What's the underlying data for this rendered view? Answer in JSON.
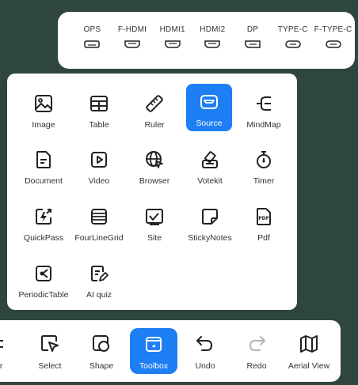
{
  "source_bar": {
    "items": [
      {
        "label": "OPS",
        "icon": "ops-port-icon"
      },
      {
        "label": "F-HDMI",
        "icon": "hdmi-port-icon"
      },
      {
        "label": "HDMI1",
        "icon": "hdmi-port-icon"
      },
      {
        "label": "HDMI2",
        "icon": "hdmi-port-icon"
      },
      {
        "label": "DP",
        "icon": "dp-port-icon"
      },
      {
        "label": "TYPE-C",
        "icon": "usb-c-port-icon"
      },
      {
        "label": "F-TYPE-C",
        "icon": "usb-c-port-icon"
      }
    ]
  },
  "toolbox": {
    "items": [
      {
        "label": "Image",
        "icon": "image-icon"
      },
      {
        "label": "Table",
        "icon": "table-icon"
      },
      {
        "label": "Ruler",
        "icon": "ruler-icon"
      },
      {
        "label": "Source",
        "icon": "source-icon",
        "active": true
      },
      {
        "label": "MindMap",
        "icon": "mindmap-icon"
      },
      {
        "label": "Document",
        "icon": "document-icon"
      },
      {
        "label": "Video",
        "icon": "video-icon"
      },
      {
        "label": "Browser",
        "icon": "browser-icon"
      },
      {
        "label": "Votekit",
        "icon": "votekit-icon"
      },
      {
        "label": "Timer",
        "icon": "timer-icon"
      },
      {
        "label": "QuickPass",
        "icon": "quickpass-icon"
      },
      {
        "label": "FourLineGrid",
        "icon": "four-line-grid-icon"
      },
      {
        "label": "Site",
        "icon": "site-icon"
      },
      {
        "label": "StickyNotes",
        "icon": "sticky-notes-icon"
      },
      {
        "label": "Pdf",
        "icon": "pdf-icon"
      },
      {
        "label": "PeriodicTable",
        "icon": "periodic-table-icon"
      },
      {
        "label": "AI quiz",
        "icon": "ai-quiz-icon"
      }
    ]
  },
  "bottom_bar": {
    "clipped_label": "er",
    "items": [
      {
        "label": "Select",
        "icon": "select-icon"
      },
      {
        "label": "Shape",
        "icon": "shape-icon"
      },
      {
        "label": "Toolbox",
        "icon": "toolbox-icon",
        "active": true
      },
      {
        "label": "Undo",
        "icon": "undo-icon"
      },
      {
        "label": "Redo",
        "icon": "redo-icon",
        "disabled": true
      },
      {
        "label": "Aerial View",
        "icon": "aerial-view-icon"
      }
    ]
  },
  "colors": {
    "background": "#2f463e",
    "accent": "#1e7ef4",
    "panel": "#ffffff",
    "icon": "#222222",
    "disabled_icon": "#b5b5b5"
  }
}
